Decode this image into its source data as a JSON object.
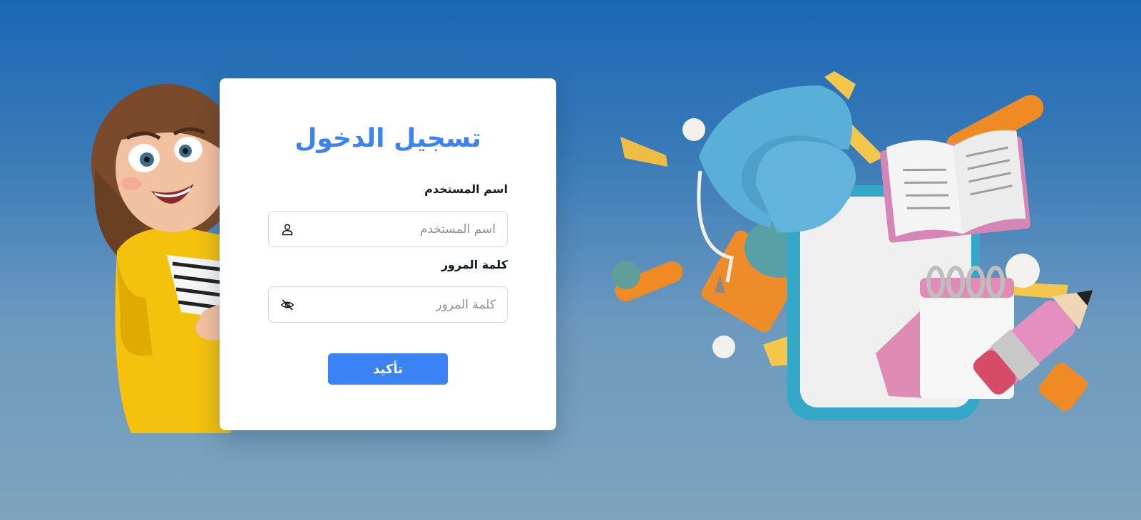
{
  "login": {
    "title": "تسجيل الدخول",
    "username_label": "اسم المستخدم",
    "username_placeholder": "اسم المستخدم",
    "username_value": "",
    "password_label": "كلمة المرور",
    "password_placeholder": "كلمة المرور",
    "password_value": "",
    "submit_label": "تأكيد"
  },
  "icons": {
    "username_field": "user-icon",
    "password_field": "eye-off-icon"
  },
  "colors": {
    "accent": "#3b82f6",
    "label_text": "#111827",
    "placeholder_text": "#8a8f98",
    "background_top": "#1a67b4",
    "background_bottom": "#7fa5bd"
  }
}
